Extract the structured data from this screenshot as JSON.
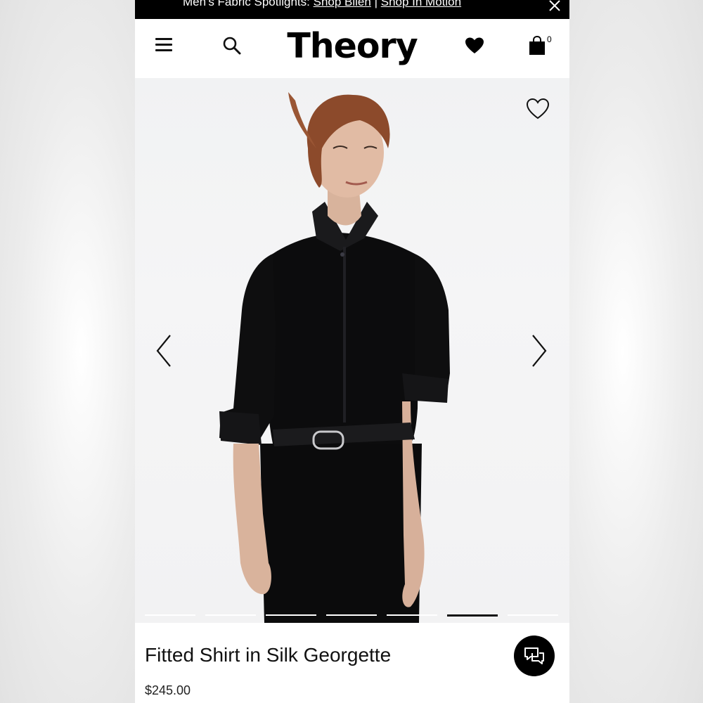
{
  "promo": {
    "lead": "Men's Fabric Spotlights:",
    "link1": "Shop Bilen",
    "separator": "|",
    "link2": "Shop In Motion"
  },
  "header": {
    "logo": "Theory",
    "bag_count": "0"
  },
  "icons": {
    "menu": "hamburger-menu-icon",
    "search": "search-icon",
    "wishlist": "heart-filled-icon",
    "bag": "shopping-bag-icon",
    "favorite": "heart-outline-icon",
    "prev": "chevron-left-icon",
    "next": "chevron-right-icon",
    "chat": "chat-bubbles-icon",
    "close": "close-icon"
  },
  "carousel": {
    "slide_count": 7,
    "active_index": 5
  },
  "product": {
    "name": "Fitted Shirt in Silk Georgette",
    "price": "$245.00"
  },
  "colors": {
    "promo_bg": "#000000",
    "accent": "#000000",
    "page_bg": "#ffffff"
  }
}
